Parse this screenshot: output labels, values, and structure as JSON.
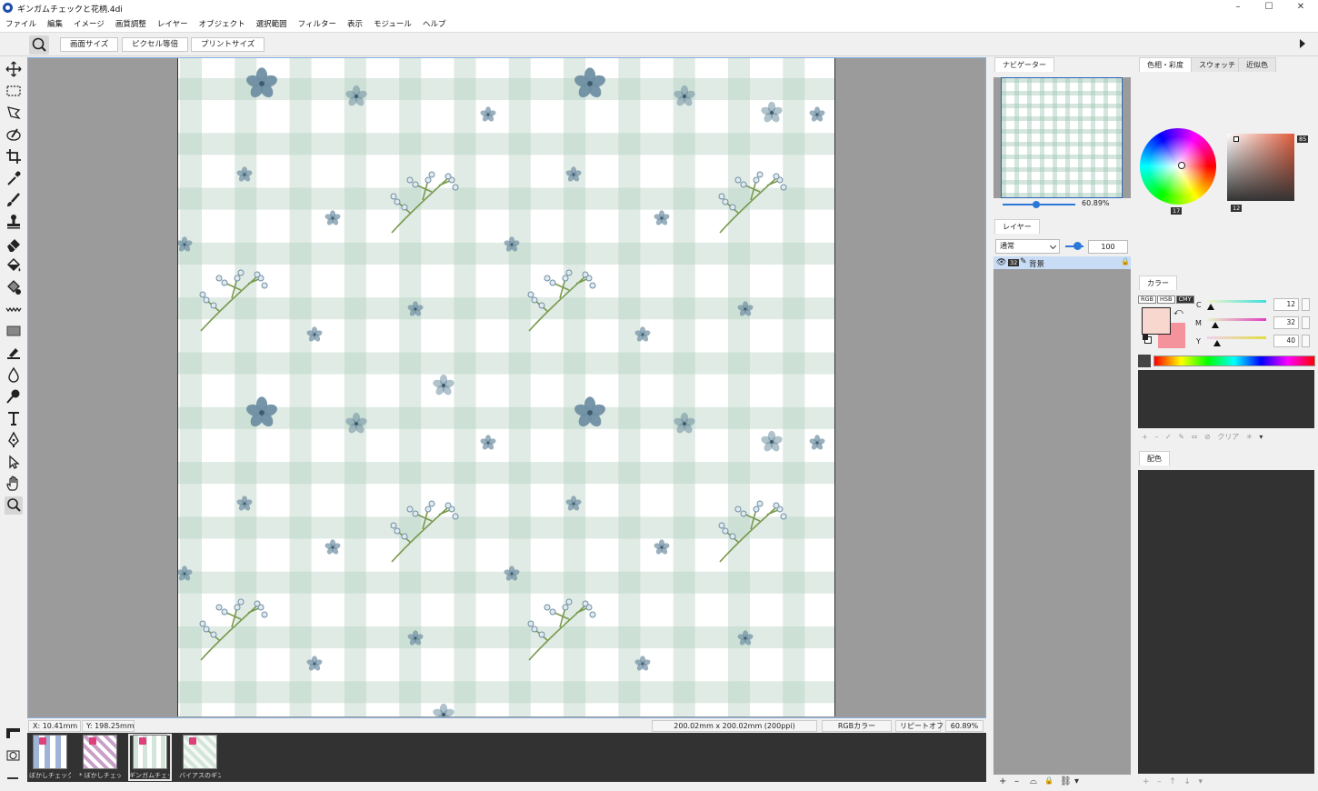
{
  "window": {
    "title": "ギンガムチェックと花柄.4di",
    "controls": [
      "–",
      "☐",
      "✕"
    ]
  },
  "menu": [
    "ファイル",
    "編集",
    "イメージ",
    "画質調整",
    "レイヤー",
    "オブジェクト",
    "選択範囲",
    "フィルター",
    "表示",
    "モジュール",
    "ヘルプ"
  ],
  "toolbar": {
    "buttons": [
      "画面サイズ",
      "ピクセル等倍",
      "プリントサイズ"
    ]
  },
  "tools": [
    "move-tool",
    "rect-select-tool",
    "lasso-tool",
    "quick-select-tool",
    "crop-tool",
    "eyedropper-tool",
    "brush-tool",
    "stamp-tool",
    "eraser-tool",
    "fill-tool",
    "gradient-fill-tool",
    "pattern-tool",
    "shape-tool",
    "fill-bucket-tool",
    "dodge-tool",
    "blur-drop-tool",
    "text-tool",
    "pen-tool",
    "path-select-tool",
    "hand-tool",
    "zoom-tool"
  ],
  "status": {
    "x": "X:   10.41mm",
    "y": "Y:  198.25mm",
    "size": "200.02mm x 200.02mm (200ppi)",
    "color_mode": "RGBカラー",
    "repeat": "リピートオフ",
    "zoom": "60.89%"
  },
  "filmstrip": [
    {
      "label": "ぼかしチェックブ…",
      "selected": false
    },
    {
      "label": "* ぼかしチェック…",
      "selected": false
    },
    {
      "label": "ギンガムチェック…",
      "selected": true
    },
    {
      "label": "バイアスのギンガ…",
      "selected": false
    }
  ],
  "navigator": {
    "tab": "ナビゲーター",
    "zoom": "60.89%"
  },
  "layers": {
    "tab": "レイヤー",
    "blend_mode": "通常",
    "opacity": "100",
    "items": [
      {
        "bit": "32",
        "name": "背景"
      }
    ],
    "bottom_icons": [
      "+",
      "–",
      "⌓",
      "🔒",
      "⛓",
      "▾"
    ]
  },
  "color_picker": {
    "tabs": [
      "色相・彩度",
      "スウォッチ",
      "近似色"
    ],
    "hue_label": "17",
    "sat_label": "12",
    "val_label": "85"
  },
  "color_panel": {
    "title": "カラー",
    "modes": [
      "RGB",
      "HSB",
      "CMY"
    ],
    "active_mode": "CMY",
    "channels": [
      {
        "name": "C",
        "value": "12"
      },
      {
        "name": "M",
        "value": "32"
      },
      {
        "name": "Y",
        "value": "40"
      }
    ],
    "fg_color": "#f7d7ce",
    "bg_color": "#f5939c",
    "swatch_actions": [
      "+",
      "–",
      "✓",
      "✎",
      "⇔",
      "⊘",
      "クリア",
      "✳",
      "▾"
    ]
  },
  "palette_panel": {
    "title": "配色",
    "actions": [
      "+",
      "–",
      "↑",
      "↓",
      "▾"
    ]
  },
  "pattern": {
    "accent": "#6f8fa3",
    "check_color": "#b7d3c3",
    "stem_color": "#7a9a4f"
  }
}
